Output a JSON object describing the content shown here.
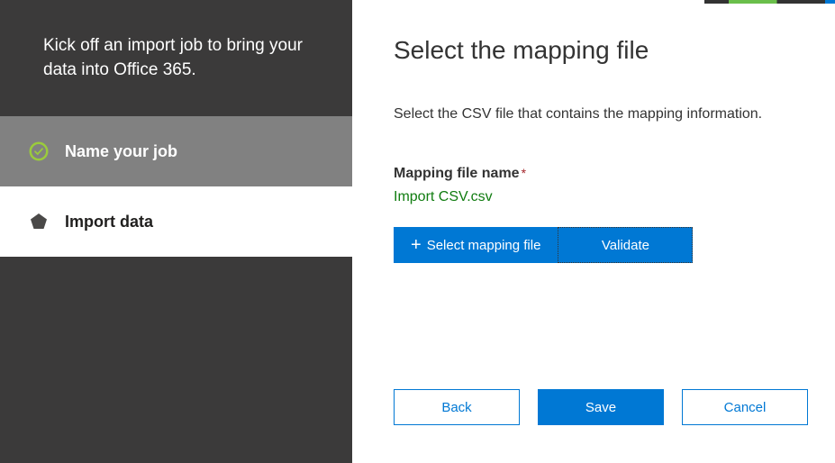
{
  "sidebar": {
    "intro": "Kick off an import job to bring your data into Office 365.",
    "steps": [
      {
        "label": "Name your job"
      },
      {
        "label": "Import data"
      }
    ]
  },
  "main": {
    "title": "Select the mapping file",
    "instruction": "Select the CSV file that contains the mapping information.",
    "field_label": "Mapping file name",
    "required_mark": "*",
    "file_name": "Import CSV.csv",
    "select_button": "Select mapping file",
    "validate_button": "Validate"
  },
  "footer": {
    "back": "Back",
    "save": "Save",
    "cancel": "Cancel"
  }
}
